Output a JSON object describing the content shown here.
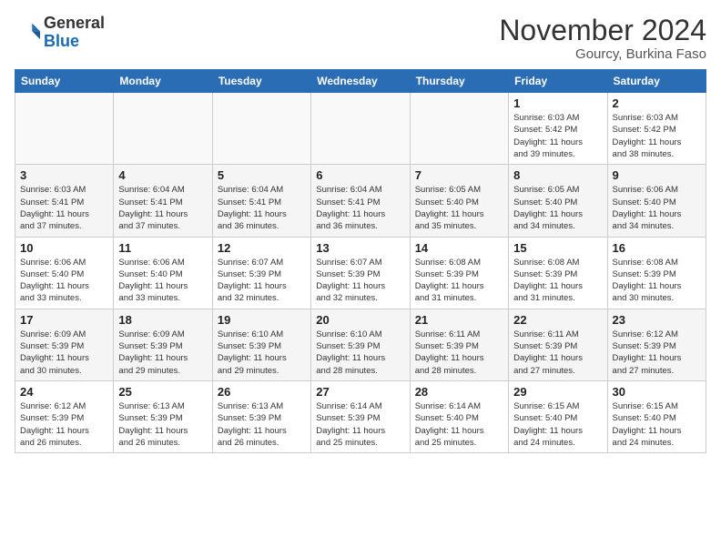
{
  "header": {
    "logo_line1": "General",
    "logo_line2": "Blue",
    "month_title": "November 2024",
    "location": "Gourcy, Burkina Faso"
  },
  "weekdays": [
    "Sunday",
    "Monday",
    "Tuesday",
    "Wednesday",
    "Thursday",
    "Friday",
    "Saturday"
  ],
  "weeks": [
    [
      {
        "day": "",
        "info": ""
      },
      {
        "day": "",
        "info": ""
      },
      {
        "day": "",
        "info": ""
      },
      {
        "day": "",
        "info": ""
      },
      {
        "day": "",
        "info": ""
      },
      {
        "day": "1",
        "info": "Sunrise: 6:03 AM\nSunset: 5:42 PM\nDaylight: 11 hours\nand 39 minutes."
      },
      {
        "day": "2",
        "info": "Sunrise: 6:03 AM\nSunset: 5:42 PM\nDaylight: 11 hours\nand 38 minutes."
      }
    ],
    [
      {
        "day": "3",
        "info": "Sunrise: 6:03 AM\nSunset: 5:41 PM\nDaylight: 11 hours\nand 37 minutes."
      },
      {
        "day": "4",
        "info": "Sunrise: 6:04 AM\nSunset: 5:41 PM\nDaylight: 11 hours\nand 37 minutes."
      },
      {
        "day": "5",
        "info": "Sunrise: 6:04 AM\nSunset: 5:41 PM\nDaylight: 11 hours\nand 36 minutes."
      },
      {
        "day": "6",
        "info": "Sunrise: 6:04 AM\nSunset: 5:41 PM\nDaylight: 11 hours\nand 36 minutes."
      },
      {
        "day": "7",
        "info": "Sunrise: 6:05 AM\nSunset: 5:40 PM\nDaylight: 11 hours\nand 35 minutes."
      },
      {
        "day": "8",
        "info": "Sunrise: 6:05 AM\nSunset: 5:40 PM\nDaylight: 11 hours\nand 34 minutes."
      },
      {
        "day": "9",
        "info": "Sunrise: 6:06 AM\nSunset: 5:40 PM\nDaylight: 11 hours\nand 34 minutes."
      }
    ],
    [
      {
        "day": "10",
        "info": "Sunrise: 6:06 AM\nSunset: 5:40 PM\nDaylight: 11 hours\nand 33 minutes."
      },
      {
        "day": "11",
        "info": "Sunrise: 6:06 AM\nSunset: 5:40 PM\nDaylight: 11 hours\nand 33 minutes."
      },
      {
        "day": "12",
        "info": "Sunrise: 6:07 AM\nSunset: 5:39 PM\nDaylight: 11 hours\nand 32 minutes."
      },
      {
        "day": "13",
        "info": "Sunrise: 6:07 AM\nSunset: 5:39 PM\nDaylight: 11 hours\nand 32 minutes."
      },
      {
        "day": "14",
        "info": "Sunrise: 6:08 AM\nSunset: 5:39 PM\nDaylight: 11 hours\nand 31 minutes."
      },
      {
        "day": "15",
        "info": "Sunrise: 6:08 AM\nSunset: 5:39 PM\nDaylight: 11 hours\nand 31 minutes."
      },
      {
        "day": "16",
        "info": "Sunrise: 6:08 AM\nSunset: 5:39 PM\nDaylight: 11 hours\nand 30 minutes."
      }
    ],
    [
      {
        "day": "17",
        "info": "Sunrise: 6:09 AM\nSunset: 5:39 PM\nDaylight: 11 hours\nand 30 minutes."
      },
      {
        "day": "18",
        "info": "Sunrise: 6:09 AM\nSunset: 5:39 PM\nDaylight: 11 hours\nand 29 minutes."
      },
      {
        "day": "19",
        "info": "Sunrise: 6:10 AM\nSunset: 5:39 PM\nDaylight: 11 hours\nand 29 minutes."
      },
      {
        "day": "20",
        "info": "Sunrise: 6:10 AM\nSunset: 5:39 PM\nDaylight: 11 hours\nand 28 minutes."
      },
      {
        "day": "21",
        "info": "Sunrise: 6:11 AM\nSunset: 5:39 PM\nDaylight: 11 hours\nand 28 minutes."
      },
      {
        "day": "22",
        "info": "Sunrise: 6:11 AM\nSunset: 5:39 PM\nDaylight: 11 hours\nand 27 minutes."
      },
      {
        "day": "23",
        "info": "Sunrise: 6:12 AM\nSunset: 5:39 PM\nDaylight: 11 hours\nand 27 minutes."
      }
    ],
    [
      {
        "day": "24",
        "info": "Sunrise: 6:12 AM\nSunset: 5:39 PM\nDaylight: 11 hours\nand 26 minutes."
      },
      {
        "day": "25",
        "info": "Sunrise: 6:13 AM\nSunset: 5:39 PM\nDaylight: 11 hours\nand 26 minutes."
      },
      {
        "day": "26",
        "info": "Sunrise: 6:13 AM\nSunset: 5:39 PM\nDaylight: 11 hours\nand 26 minutes."
      },
      {
        "day": "27",
        "info": "Sunrise: 6:14 AM\nSunset: 5:39 PM\nDaylight: 11 hours\nand 25 minutes."
      },
      {
        "day": "28",
        "info": "Sunrise: 6:14 AM\nSunset: 5:40 PM\nDaylight: 11 hours\nand 25 minutes."
      },
      {
        "day": "29",
        "info": "Sunrise: 6:15 AM\nSunset: 5:40 PM\nDaylight: 11 hours\nand 24 minutes."
      },
      {
        "day": "30",
        "info": "Sunrise: 6:15 AM\nSunset: 5:40 PM\nDaylight: 11 hours\nand 24 minutes."
      }
    ]
  ]
}
